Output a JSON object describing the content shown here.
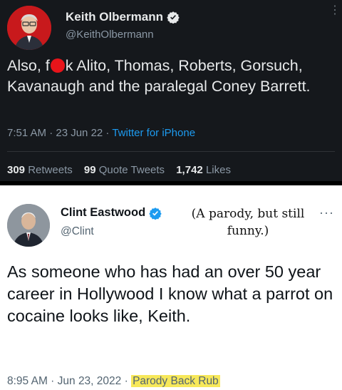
{
  "dark_tweet": {
    "display_name": "Keith Olbermann",
    "handle": "@KeithOlbermann",
    "body_before": "Also, f",
    "body_after": "k Alito, Thomas, Roberts, Gorsuch, Kavanaugh and the paralegal Coney Barrett.",
    "time": "7:51 AM · 23 Jun 22 · ",
    "client": "Twitter for iPhone",
    "retweets_count": "309",
    "retweets_label": "Retweets",
    "quotes_count": "99",
    "quotes_label": "Quote Tweets",
    "likes_count": "1,742",
    "likes_label": "Likes",
    "colors": {
      "background": "#15181c",
      "link": "#1d9bf0",
      "censor_dot": "#e8141a"
    }
  },
  "light_tweet": {
    "display_name": "Clint Eastwood",
    "handle": "@Clint",
    "annotation": "(A parody, but still funny.)",
    "body": "As someone who has had an over 50 year career in Hollywood I know what a parrot on cocaine looks like, Keith.",
    "time": "8:95 AM · Jun 23, 2022 · ",
    "client": "Parody Back Rub",
    "colors": {
      "background": "#ffffff",
      "highlight": "#f7e85a"
    }
  },
  "icons": [
    "verified-badge-icon",
    "more-options-icon"
  ]
}
